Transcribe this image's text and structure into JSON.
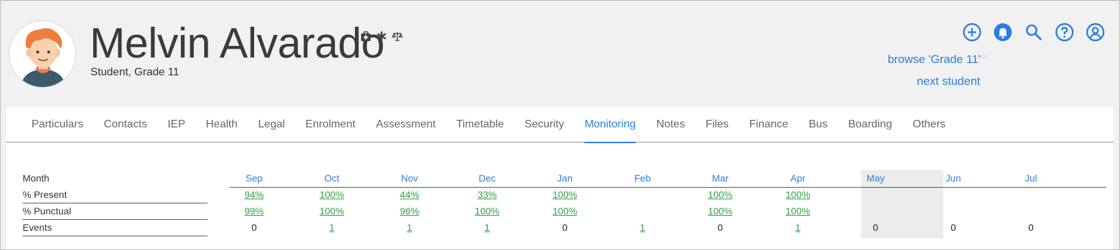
{
  "header": {
    "name": "Melvin Alvarado",
    "subtitle": "Student, Grade 11",
    "status_icons": [
      "medical-kit-icon",
      "asterisk-icon",
      "scales-icon"
    ],
    "actions": [
      "add-circle-icon",
      "bell-icon",
      "search-icon",
      "help-icon",
      "account-icon"
    ],
    "browse_label": "browse 'Grade 11'",
    "next_label": "next student"
  },
  "tabs": [
    {
      "label": "Particulars"
    },
    {
      "label": "Contacts"
    },
    {
      "label": "IEP"
    },
    {
      "label": "Health"
    },
    {
      "label": "Legal"
    },
    {
      "label": "Enrolment"
    },
    {
      "label": "Assessment"
    },
    {
      "label": "Timetable"
    },
    {
      "label": "Security"
    },
    {
      "label": "Monitoring",
      "active": true
    },
    {
      "label": "Notes"
    },
    {
      "label": "Files"
    },
    {
      "label": "Finance"
    },
    {
      "label": "Bus"
    },
    {
      "label": "Boarding"
    },
    {
      "label": "Others"
    }
  ],
  "monitoring": {
    "row_labels": [
      "Month",
      "% Present",
      "% Punctual",
      "Events"
    ],
    "months": [
      "Sep",
      "Oct",
      "Nov",
      "Dec",
      "Jan",
      "Feb",
      "Mar",
      "Apr",
      "May",
      "Jun",
      "Jul"
    ],
    "present": [
      "94%",
      "100%",
      "44%",
      "33%",
      "100%",
      "",
      "100%",
      "100%",
      "",
      "",
      ""
    ],
    "punctual": [
      "99%",
      "100%",
      "96%",
      "100%",
      "100%",
      "",
      "100%",
      "100%",
      "",
      "",
      ""
    ],
    "events": [
      "0",
      "1",
      "1",
      "1",
      "0",
      "1",
      "0",
      "1",
      "0",
      "0",
      "0"
    ],
    "highlighted_month": "May"
  },
  "colors": {
    "accent": "#2b7de0",
    "link_green": "#2ea043",
    "background": "#f1f1f1"
  }
}
